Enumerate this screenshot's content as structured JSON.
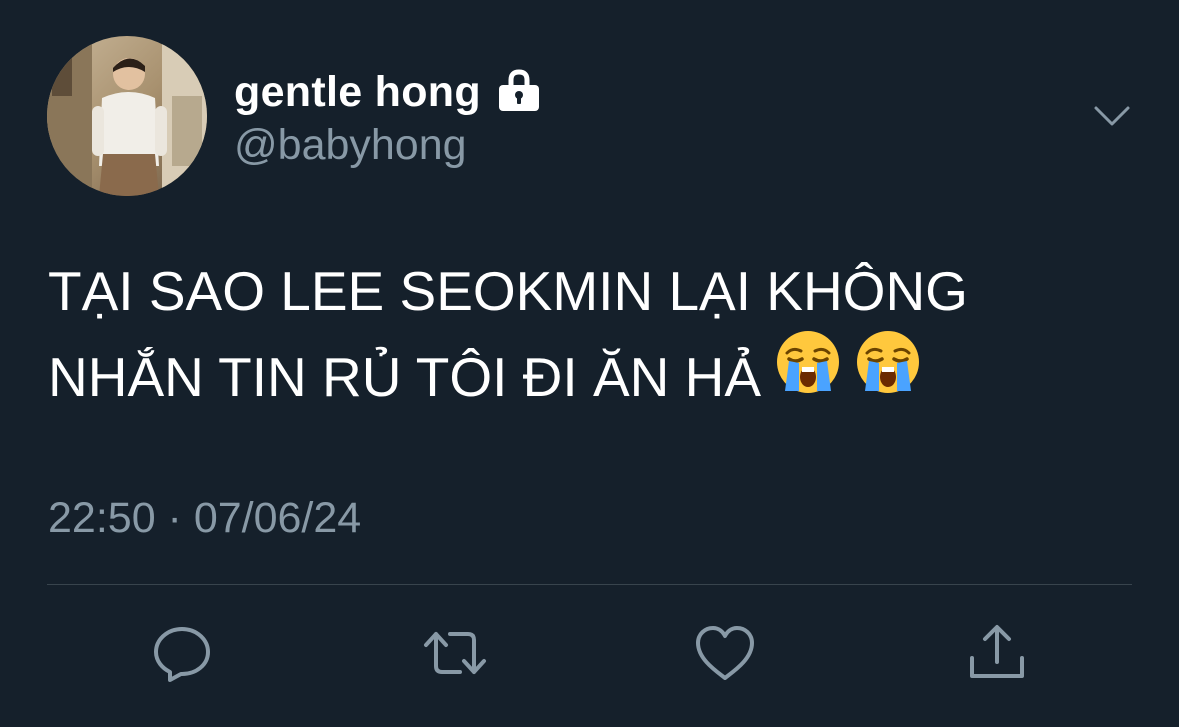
{
  "tweet": {
    "display_name": "gentle hong",
    "handle": "@babyhong",
    "text_line_1": "TẠI SAO LEE SEOKMIN LẠI KHÔNG",
    "text_line_2": "NHẮN TIN RỦ TÔI ĐI ĂN HẢ",
    "emojis": [
      "loudly-crying-face-emoji",
      "loudly-crying-face-emoji"
    ],
    "timestamp": "22:50 · 07/06/24",
    "protected": true
  },
  "icons": {
    "lock": "lock-icon",
    "more": "chevron-down-icon",
    "reply": "reply-icon",
    "retweet": "retweet-icon",
    "like": "heart-icon",
    "share": "share-icon"
  },
  "colors": {
    "background": "#15202b",
    "primary_text": "#ffffff",
    "secondary_text": "#8899a6",
    "divider": "#38444d"
  }
}
